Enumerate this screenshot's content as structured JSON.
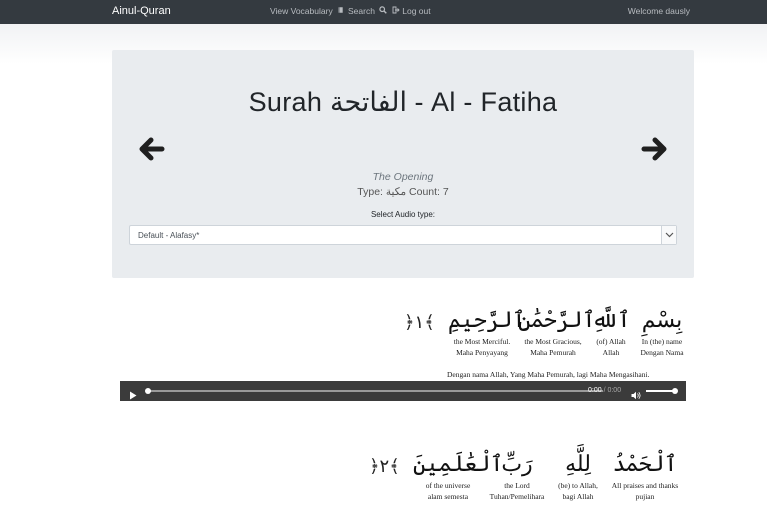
{
  "navbar": {
    "brand": "Ainul-Quran",
    "vocab": "View Vocabulary",
    "search": "Search",
    "logout": "Log out",
    "welcome": "Welcome dausly"
  },
  "surah": {
    "title": "Surah الفاتحة - Al - Fatiha",
    "subtitle": "The Opening",
    "type_count": "Type: مكية Count: 7",
    "audio_label": "Select Audio type:",
    "audio_selected": "Default - Alafasy*"
  },
  "verses": [
    {
      "marker": "﴿١﴾",
      "words": [
        {
          "ar": "بِسْمِ",
          "en": "In (the) name",
          "id": "Dengan Nama"
        },
        {
          "ar": "ٱللَّهِ",
          "en": "(of) Allah",
          "id": "Allah"
        },
        {
          "ar": "ٱلرَّحْمَٰنِ",
          "en": "the Most Gracious,",
          "id": "Maha Pemurah"
        },
        {
          "ar": "ٱلرَّحِيمِ",
          "en": "the Most Merciful.",
          "id": "Maha Penyayang"
        }
      ],
      "translation": "Dengan nama Allah, Yang Maha Pemurah, lagi Maha Mengasihani."
    },
    {
      "marker": "﴿٢﴾",
      "words": [
        {
          "ar": "ٱلْحَمْدُ",
          "en": "All praises and thanks",
          "id": "pujian"
        },
        {
          "ar": "لِلَّهِ",
          "en": "(be) to Allah,",
          "id": "bagi Allah"
        },
        {
          "ar": "رَبِّ",
          "en": "the Lord",
          "id": "Tuhan/Pemelihara"
        },
        {
          "ar": "ٱلْعَٰلَمِينَ",
          "en": "of the universe",
          "id": "alam semesta"
        }
      ]
    }
  ],
  "player": {
    "time_current": "0:00",
    "time_total": "0:00",
    "progress": 0
  },
  "icons": [
    "book-icon",
    "search-icon",
    "logout-icon",
    "arrow-left-icon",
    "arrow-right-icon",
    "chevron-down-icon",
    "play-icon",
    "volume-icon"
  ]
}
